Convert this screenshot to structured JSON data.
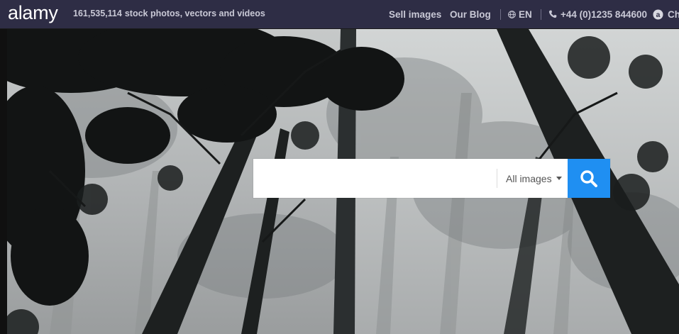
{
  "header": {
    "logo": "alamy",
    "count": "161,535,114",
    "tagline_text": "stock photos, vectors and videos",
    "nav": {
      "sell_images": "Sell images",
      "our_blog": "Our Blog",
      "language": "EN",
      "phone": "+44 (0)1235 844600",
      "account_partial": "Ch"
    }
  },
  "search": {
    "placeholder": "",
    "value": "",
    "filter_selected": "All images"
  },
  "icons": {
    "globe": "globe-icon",
    "phone": "phone-icon",
    "account": "account-icon",
    "search": "search-icon",
    "caret": "chevron-down-icon"
  },
  "colors": {
    "header_bg": "#2e2d45",
    "search_button": "#1f8ff2",
    "header_text": "#c9c9d6"
  }
}
